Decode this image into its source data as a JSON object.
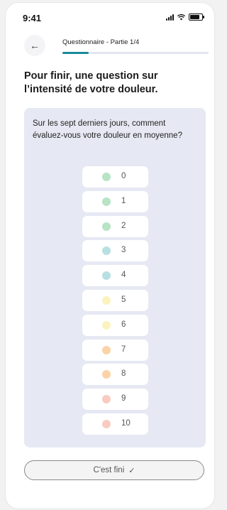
{
  "status_bar": {
    "time": "9:41"
  },
  "header": {
    "back_icon": "arrow-left-icon",
    "progress_title": "Questionnaire - Partie 1/4",
    "progress_fraction": 0.18
  },
  "title": "Pour finir, une question sur l’intensité de votre douleur.",
  "question": {
    "text": "Sur les sept derniers jours, comment évaluez-vous votre douleur en moyenne?",
    "options": [
      {
        "label": "0",
        "color": "#b6e4c5"
      },
      {
        "label": "1",
        "color": "#b6e4c5"
      },
      {
        "label": "2",
        "color": "#b6e4c5"
      },
      {
        "label": "3",
        "color": "#b8e0e3"
      },
      {
        "label": "4",
        "color": "#b8e0e3"
      },
      {
        "label": "5",
        "color": "#fbf3bf"
      },
      {
        "label": "6",
        "color": "#fbf3bf"
      },
      {
        "label": "7",
        "color": "#fbd3a6"
      },
      {
        "label": "8",
        "color": "#fbd3a6"
      },
      {
        "label": "9",
        "color": "#f9cbc2"
      },
      {
        "label": "10",
        "color": "#f9cbc2"
      }
    ]
  },
  "footer": {
    "finish_label": "C'est fini",
    "finish_icon": "check-icon"
  }
}
